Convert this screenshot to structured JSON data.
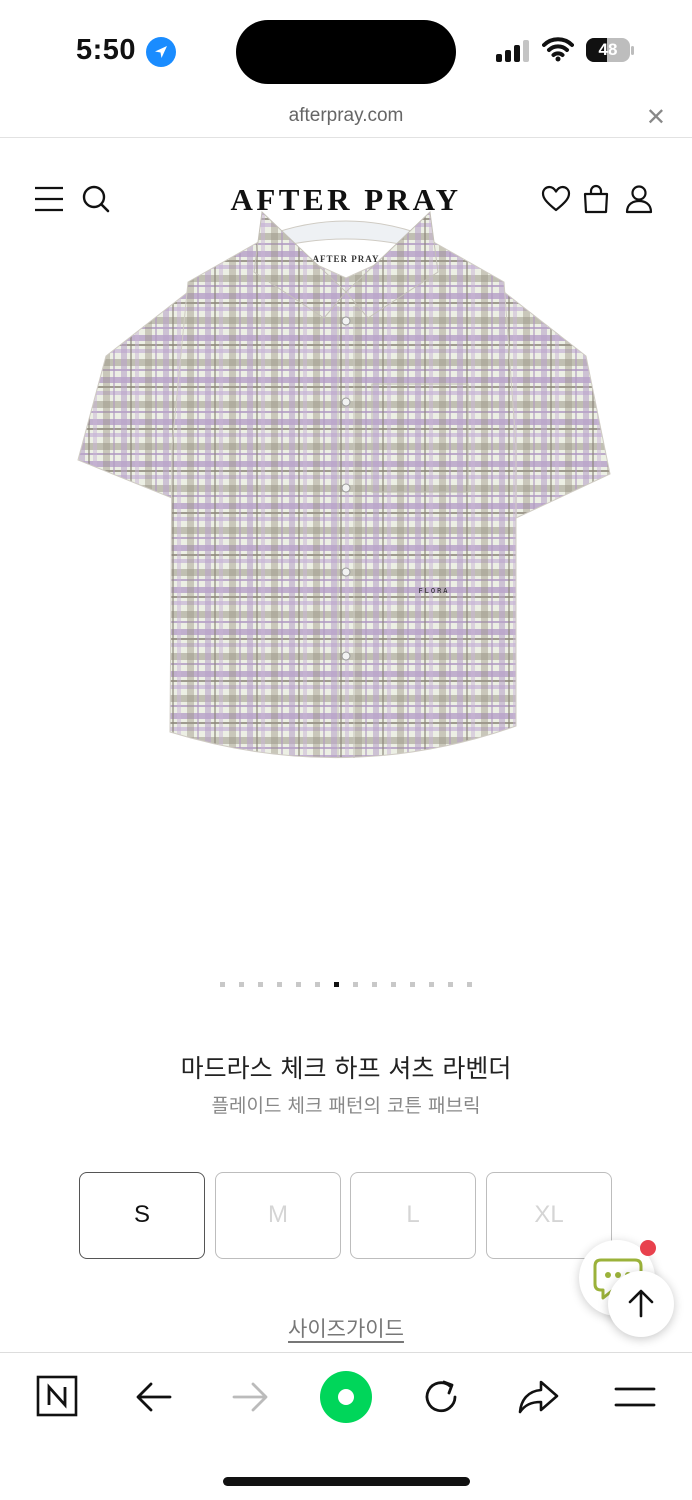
{
  "status_bar": {
    "time": "5:50",
    "battery": "48",
    "battery_level": 0.48,
    "icons": [
      "location-arrow-icon",
      "cellular-signal-icon",
      "wifi-icon",
      "battery-icon"
    ]
  },
  "browser": {
    "url": "afterpray.com",
    "close_icon": "✕"
  },
  "header": {
    "logo": "AFTER PRAY",
    "icons": [
      "menu-icon",
      "search-icon",
      "heart-icon",
      "bag-icon",
      "user-icon"
    ]
  },
  "product": {
    "image_label": "FLORA",
    "collar_label": "AFTER PRAY",
    "title": "마드라스 체크 하프 셔츠 라벤더",
    "subtitle": "플레이드 체크 패턴의 코튼 패브릭",
    "carousel": {
      "total": 14,
      "active": 7
    },
    "sizes": [
      {
        "label": "S",
        "available": true
      },
      {
        "label": "M",
        "available": false
      },
      {
        "label": "L",
        "available": false
      },
      {
        "label": "XL",
        "available": false
      }
    ],
    "size_guide": "사이즈가이드"
  },
  "floating": {
    "chat_icon": "chat-icon",
    "top_icon": "arrow-up-icon",
    "badge_color": "#e8414d"
  },
  "toolbar": {
    "icons": [
      "naver-icon",
      "back-arrow-icon",
      "forward-arrow-icon",
      "green-dot-icon",
      "refresh-icon",
      "share-icon",
      "hamburger-icon"
    ],
    "accent_color": "#00d65a"
  }
}
